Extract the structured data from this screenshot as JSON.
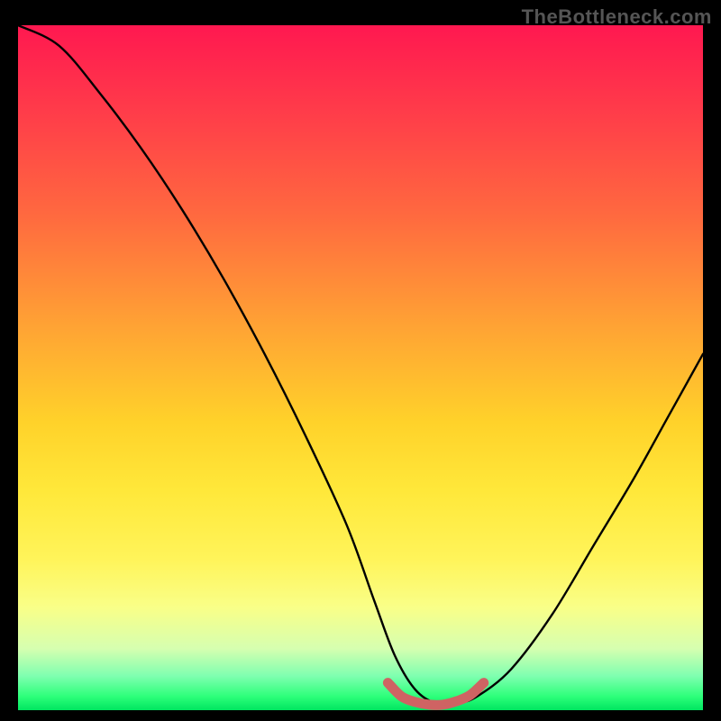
{
  "attribution": "TheBottleneck.com",
  "chart_data": {
    "type": "line",
    "title": "",
    "xlabel": "",
    "ylabel": "",
    "xlim": [
      0,
      100
    ],
    "ylim": [
      0,
      100
    ],
    "grid": false,
    "legend": false,
    "series": [
      {
        "name": "bottleneck-curve",
        "x": [
          0,
          6,
          12,
          18,
          24,
          30,
          36,
          42,
          48,
          52,
          55,
          58,
          61,
          64,
          67,
          72,
          78,
          84,
          90,
          95,
          100
        ],
        "values": [
          100,
          97,
          90,
          82,
          73,
          63,
          52,
          40,
          27,
          16,
          8,
          3,
          1,
          1,
          2,
          6,
          14,
          24,
          34,
          43,
          52
        ]
      },
      {
        "name": "optimal-range",
        "x": [
          54,
          56,
          58,
          60,
          62,
          64,
          66,
          68
        ],
        "values": [
          4,
          2,
          1.2,
          0.8,
          0.8,
          1.3,
          2.2,
          4
        ]
      }
    ],
    "gradient_stops": [
      {
        "pos": 0,
        "color": "#ff1850"
      },
      {
        "pos": 28,
        "color": "#ff6a3f"
      },
      {
        "pos": 58,
        "color": "#ffd22a"
      },
      {
        "pos": 85,
        "color": "#f9ff88"
      },
      {
        "pos": 100,
        "color": "#00e560"
      }
    ]
  }
}
